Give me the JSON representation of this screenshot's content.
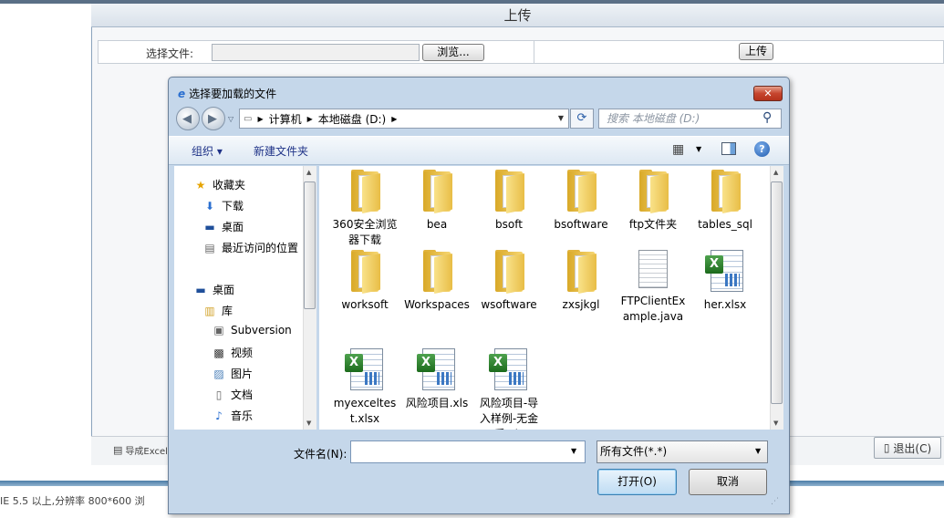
{
  "page": {
    "title": "上传",
    "file_label": "选择文件:",
    "browse_label": "浏览...",
    "upload_label": "上传",
    "export_label": "导成Excel",
    "exit_label": "退出(C)",
    "browser_note": "IE 5.5 以上,分辨率 800*600 浏"
  },
  "dialog": {
    "title": "选择要加载的文件",
    "close_label": "✕",
    "breadcrumb": [
      "计算机",
      "本地磁盘 (D:)"
    ],
    "search_placeholder": "搜索 本地磁盘 (D:)",
    "toolbar": {
      "organize": "组织 ▾",
      "new_folder": "新建文件夹"
    },
    "nav": {
      "favorites": "收藏夹",
      "downloads": "下载",
      "desktop_fav": "桌面",
      "recent": "最近访问的位置",
      "desktop": "桌面",
      "libraries": "库",
      "subversion": "Subversion",
      "videos": "视频",
      "pictures": "图片",
      "documents": "文档",
      "music": "音乐"
    },
    "files": [
      {
        "name": "360安全浏览器下载",
        "type": "folder"
      },
      {
        "name": "bea",
        "type": "folder"
      },
      {
        "name": "bsoft",
        "type": "folder"
      },
      {
        "name": "bsoftware",
        "type": "folder"
      },
      {
        "name": "ftp文件夹",
        "type": "folder"
      },
      {
        "name": "tables_sql",
        "type": "folder"
      },
      {
        "name": "worksoft",
        "type": "folder"
      },
      {
        "name": "Workspaces",
        "type": "folder"
      },
      {
        "name": "wsoftware",
        "type": "folder"
      },
      {
        "name": "zxsjkgl",
        "type": "folder"
      },
      {
        "name": "FTPClientExample.java",
        "type": "document"
      },
      {
        "name": "her.xlsx",
        "type": "excel"
      },
      {
        "name": "myexceltest.xlsx",
        "type": "excel"
      },
      {
        "name": "风险项目.xls",
        "type": "excel"
      },
      {
        "name": "风险项目-导入样例-无金质.xls",
        "type": "excel"
      }
    ],
    "filename_label": "文件名(N):",
    "filename_value": "",
    "filter_value": "所有文件(*.*)",
    "open_label": "打开(O)",
    "cancel_label": "取消"
  },
  "colors": {
    "dialog_bg": "#c5d7ea",
    "link_text": "#1e3287",
    "close_red": "#c6452e"
  }
}
